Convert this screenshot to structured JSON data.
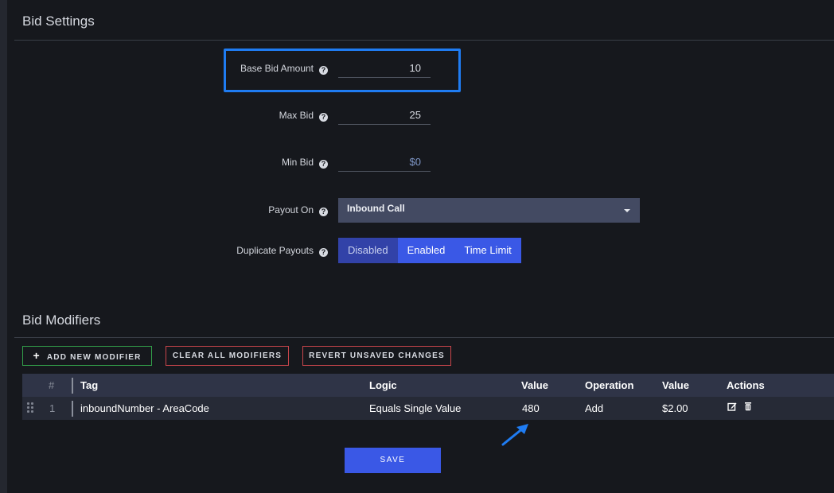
{
  "bid_settings": {
    "title": "Bid Settings",
    "base_bid": {
      "label": "Base Bid Amount",
      "value": "10"
    },
    "max_bid": {
      "label": "Max Bid",
      "value": "25"
    },
    "min_bid": {
      "label": "Min Bid",
      "placeholder": "$0",
      "value": ""
    },
    "payout_on": {
      "label": "Payout On",
      "selected": "Inbound Call"
    },
    "duplicate_payouts": {
      "label": "Duplicate Payouts",
      "options": [
        "Disabled",
        "Enabled",
        "Time Limit"
      ],
      "selected": "Disabled"
    },
    "help_glyph": "?"
  },
  "bid_modifiers": {
    "title": "Bid Modifiers",
    "buttons": {
      "add_plus": "+",
      "add": "ADD NEW MODIFIER",
      "clear": "CLEAR ALL MODIFIERS",
      "revert": "REVERT UNSAVED CHANGES"
    },
    "table": {
      "headers": [
        "#",
        "Tag",
        "Logic",
        "Value",
        "Operation",
        "Value",
        "Actions"
      ],
      "rows": [
        {
          "index": "1",
          "tag": "inboundNumber - AreaCode",
          "logic": "Equals Single Value",
          "value": "480",
          "operation": "Add",
          "amount": "$2.00"
        }
      ]
    }
  },
  "save_label": "SAVE",
  "colors": {
    "background": "#16181d",
    "accent": "#3a58e6",
    "highlight": "#1f7cf2",
    "add_border": "#33a04a",
    "danger_border": "#c9454b"
  },
  "icons": [
    "help-icon",
    "chevron-down-icon",
    "plus-icon",
    "drag-handle-icon",
    "edit-icon",
    "trash-icon",
    "arrow-annotation-icon"
  ]
}
